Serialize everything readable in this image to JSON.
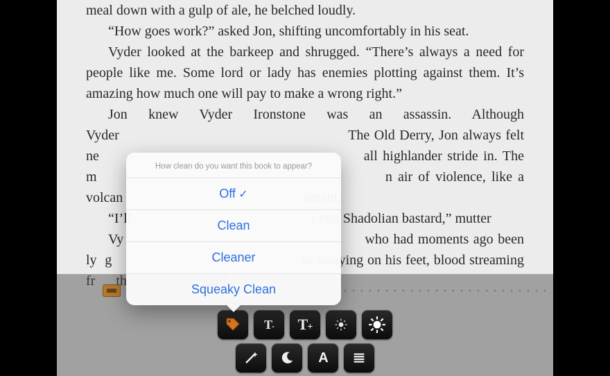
{
  "book_text": {
    "p1": "meal down with a gulp of ale, he belched loudly.",
    "p2": "“How goes work?” asked Jon, shifting uncomfortably in his seat.",
    "p3": "Vyder looked at the barkeep and shrugged. “There’s always a need for people like me. Some lord or lady has enemies plotting against them. It’s amazing how much one will pay to make a wrong right.”",
    "p4": "Jon knew Vyder Ironstone was an assassin. Although Vyder                                                   The Old Derry, Jon always felt ne                                                   all highlander stride in. The  m                                                   n  air  of  violence,  like  a volcan                                                    oment.",
    "p5": "“I’ll                                                    : you Shadolian bastard,” mutter",
    "p6": "Vy                                                     who  had  moments  ago been  ly  g                                               as  swaying  on  his  feet, blood streaming fr      the     de     hi    outh."
  },
  "popover": {
    "title": "How clean do you want this book to appear?",
    "options": [
      "Off",
      "Clean",
      "Cleaner",
      "Squeaky Clean"
    ],
    "selected_index": 0
  },
  "toolbar": {
    "row1": {
      "clean": "clean-tag-icon",
      "text_smaller": "T-",
      "text_larger": "T+",
      "brightness_down": "brightness-down-icon",
      "brightness_up": "brightness-up-icon"
    },
    "row2": {
      "wand": "magic-wand-icon",
      "night": "night-mode-icon",
      "font": "A",
      "lines": "line-spacing-icon"
    }
  },
  "colors": {
    "accent": "#2d6fe0",
    "tag": "#e07a1f"
  }
}
